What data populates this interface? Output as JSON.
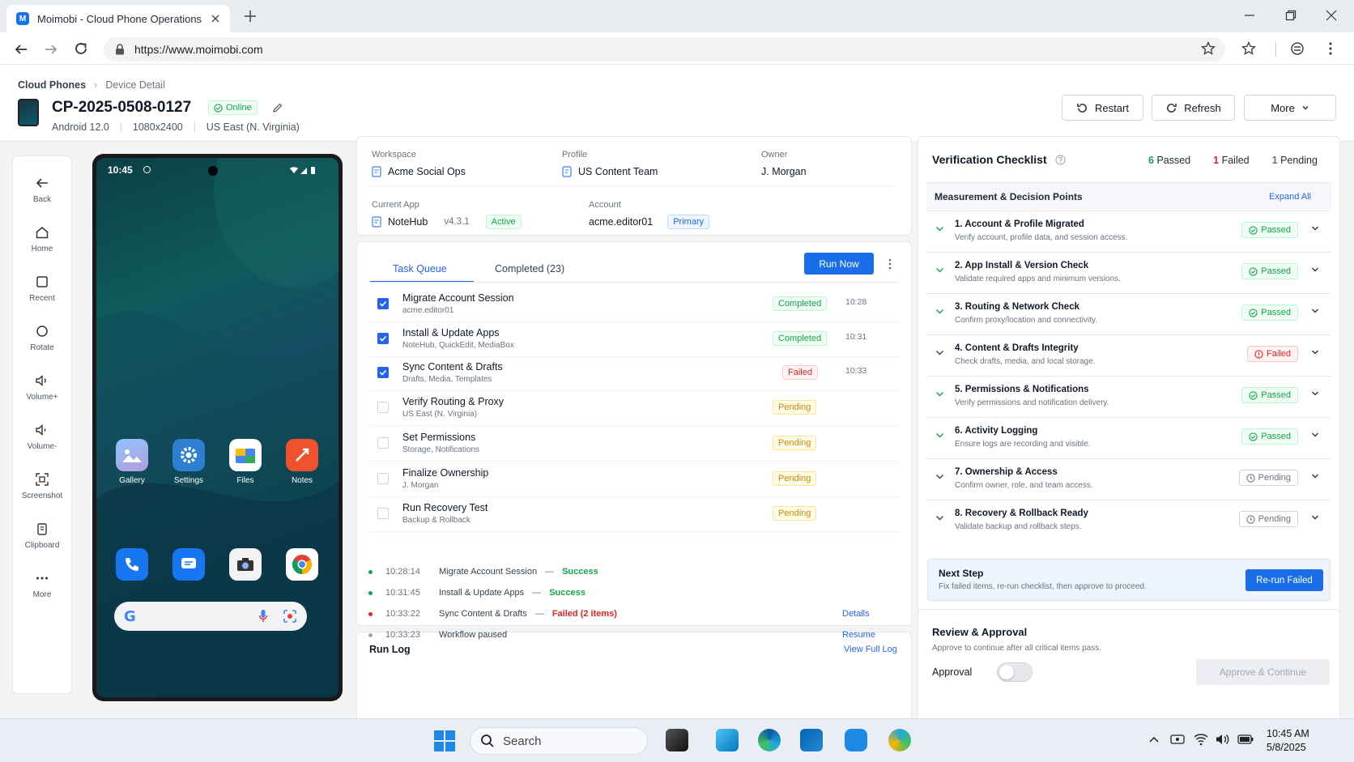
{
  "browser": {
    "tab_title": "Moimobi - Cloud Phone Operations",
    "favicon_letter": "M",
    "url": "https://www.moimobi.com"
  },
  "breadcrumb": {
    "root": "Cloud Phones",
    "current": "Device Detail"
  },
  "device": {
    "id": "CP-2025-0508-0127",
    "status": "Online",
    "os": "Android 12.0",
    "resolution": "1080x2400",
    "region": "US East (N. Virginia)"
  },
  "header_actions": {
    "restart": "Restart",
    "refresh": "Refresh",
    "more": "More"
  },
  "sidebar": [
    {
      "label": "Back",
      "icon": "arrow-left-icon"
    },
    {
      "label": "Home",
      "icon": "home-icon"
    },
    {
      "label": "Recent",
      "icon": "recent-icon"
    },
    {
      "label": "Rotate",
      "icon": "rotate-icon"
    },
    {
      "label": "Volume+",
      "icon": "volume-up-icon"
    },
    {
      "label": "Volume-",
      "icon": "volume-down-icon"
    },
    {
      "label": "Screenshot",
      "icon": "screenshot-icon"
    },
    {
      "label": "Clipboard",
      "icon": "clipboard-icon"
    },
    {
      "label": "More",
      "icon": "more-dots-icon"
    }
  ],
  "phone": {
    "time": "10:45",
    "apps_row1": [
      "Gallery",
      "Settings",
      "Files",
      "Notes"
    ]
  },
  "info": {
    "workspace_label": "Workspace",
    "workspace": "Acme Social Ops",
    "profile_label": "Profile",
    "profile": "US Content Team",
    "owner_label": "Owner",
    "owner": "J. Morgan",
    "current_app_label": "Current App",
    "current_app": "NoteHub",
    "app_version": "v4.3.1",
    "app_status": "Active",
    "account_label": "Account",
    "account": "acme.editor01",
    "account_tag": "Primary"
  },
  "tasks": {
    "tab_queue": "Task Queue",
    "tab_completed": "Completed (23)",
    "run_now": "Run Now",
    "items": [
      {
        "title": "Migrate Account Session",
        "sub": "acme.editor01",
        "status": "Completed",
        "time": "10:28",
        "checked": true
      },
      {
        "title": "Install & Update Apps",
        "sub": "NoteHub, QuickEdit, MediaBox",
        "status": "Completed",
        "time": "10:31",
        "checked": true
      },
      {
        "title": "Sync Content & Drafts",
        "sub": "Drafts, Media, Templates",
        "status": "Failed",
        "time": "10:33",
        "checked": true
      },
      {
        "title": "Verify Routing & Proxy",
        "sub": "US East (N. Virginia)",
        "status": "Pending",
        "time": "",
        "checked": false
      },
      {
        "title": "Set Permissions",
        "sub": "Storage, Notifications",
        "status": "Pending",
        "time": "",
        "checked": false
      },
      {
        "title": "Finalize Ownership",
        "sub": "J. Morgan",
        "status": "Pending",
        "time": "",
        "checked": false
      },
      {
        "title": "Run Recovery Test",
        "sub": "Backup & Rollback",
        "status": "Pending",
        "time": "",
        "checked": false
      }
    ]
  },
  "runlog": {
    "title": "Run Log",
    "view_full": "View Full Log",
    "entries": [
      {
        "time": "10:28:14",
        "task": "Migrate Account Session",
        "dash": "—",
        "result": "Success",
        "color": "#16a34a",
        "action": ""
      },
      {
        "time": "10:31:45",
        "task": "Install & Update Apps",
        "dash": "—",
        "result": "Success",
        "color": "#16a34a",
        "action": ""
      },
      {
        "time": "10:33:22",
        "task": "Sync Content & Drafts",
        "dash": "—",
        "result": "Failed (2 items)",
        "color": "#dc2626",
        "action": "Details"
      },
      {
        "time": "10:33:23",
        "task": "Workflow paused",
        "dash": "",
        "result": "",
        "color": "#9ca3af",
        "action": "Resume"
      }
    ]
  },
  "checklist": {
    "title": "Verification Checklist",
    "passed_count": "6",
    "passed_label": "Passed",
    "failed_count": "1",
    "failed_label": "Failed",
    "pending_count": "1",
    "pending_label": "Pending",
    "section": "Measurement & Decision Points",
    "expand_all": "Expand All",
    "items": [
      {
        "title": "1. Account & Profile Migrated",
        "sub": "Verify account, profile data, and session access.",
        "status": "Passed"
      },
      {
        "title": "2. App Install & Version Check",
        "sub": "Validate required apps and minimum versions.",
        "status": "Passed"
      },
      {
        "title": "3. Routing & Network Check",
        "sub": "Confirm proxy/location and connectivity.",
        "status": "Passed"
      },
      {
        "title": "4. Content & Drafts Integrity",
        "sub": "Check drafts, media, and local storage.",
        "status": "Failed"
      },
      {
        "title": "5. Permissions & Notifications",
        "sub": "Verify permissions and notification delivery.",
        "status": "Passed"
      },
      {
        "title": "6. Activity Logging",
        "sub": "Ensure logs are recording and visible.",
        "status": "Passed"
      },
      {
        "title": "7. Ownership & Access",
        "sub": "Confirm owner, role, and team access.",
        "status": "Pending"
      },
      {
        "title": "8. Recovery & Rollback Ready",
        "sub": "Validate backup and rollback steps.",
        "status": "Pending"
      }
    ],
    "next_step_title": "Next Step",
    "next_step_text": "Fix failed items, re-run checklist, then approve to proceed.",
    "rerun": "Re-run Failed"
  },
  "review": {
    "title": "Review & Approval",
    "sub": "Approve to continue after all critical items pass.",
    "approval_label": "Approval",
    "approve_btn": "Approve & Continue"
  },
  "taskbar": {
    "search": "Search",
    "time": "10:45 AM",
    "date": "5/8/2025"
  }
}
